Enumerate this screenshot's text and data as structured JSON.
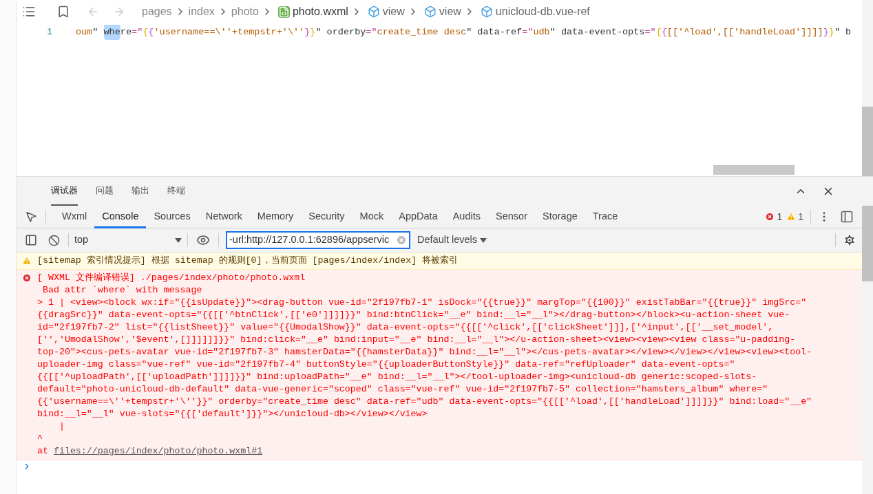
{
  "editor": {
    "breadcrumb": [
      {
        "label": "pages",
        "kind": "folder"
      },
      {
        "label": "index",
        "kind": "folder"
      },
      {
        "label": "photo",
        "kind": "folder"
      },
      {
        "label": "photo.wxml",
        "kind": "file"
      },
      {
        "label": "view",
        "kind": "node"
      },
      {
        "label": "view",
        "kind": "node"
      },
      {
        "label": "unicloud-db.vue-ref",
        "kind": "node"
      }
    ],
    "line_number": "1",
    "code": [
      {
        "text": "oum",
        "kind": "string"
      },
      {
        "text": "\" ",
        "kind": "plain"
      },
      {
        "text": "whe",
        "kind": "match"
      },
      {
        "text": "re",
        "kind": "plain"
      },
      {
        "text": "=\"",
        "kind": "eq"
      },
      {
        "text": "{",
        "kind": "brace1"
      },
      {
        "text": "{",
        "kind": "brace2"
      },
      {
        "text": "'username==\\''+tempstr+'\\''",
        "kind": "string"
      },
      {
        "text": "}",
        "kind": "brace2"
      },
      {
        "text": "}",
        "kind": "brace1"
      },
      {
        "text": "\" orderby",
        "kind": "plain"
      },
      {
        "text": "=\"",
        "kind": "eq"
      },
      {
        "text": "create_time desc",
        "kind": "string"
      },
      {
        "text": "\" data-ref",
        "kind": "plain"
      },
      {
        "text": "=\"",
        "kind": "eq"
      },
      {
        "text": "udb",
        "kind": "string"
      },
      {
        "text": "\" data-event-opts",
        "kind": "plain"
      },
      {
        "text": "=\"",
        "kind": "eq"
      },
      {
        "text": "{",
        "kind": "brace1"
      },
      {
        "text": "{",
        "kind": "brace2"
      },
      {
        "text": "[['^load',[['handleLoad']]]]",
        "kind": "string"
      },
      {
        "text": "}",
        "kind": "brace2"
      },
      {
        "text": "}",
        "kind": "brace1"
      },
      {
        "text": "\" b",
        "kind": "plain"
      }
    ]
  },
  "panel_tabs": [
    {
      "label": "调试器",
      "selected": true
    },
    {
      "label": "问题",
      "selected": false
    },
    {
      "label": "输出",
      "selected": false
    },
    {
      "label": "终端",
      "selected": false
    }
  ],
  "devtools_tabs": [
    {
      "label": "Wxml",
      "selected": false
    },
    {
      "label": "Console",
      "selected": true
    },
    {
      "label": "Sources",
      "selected": false
    },
    {
      "label": "Network",
      "selected": false
    },
    {
      "label": "Memory",
      "selected": false
    },
    {
      "label": "Security",
      "selected": false
    },
    {
      "label": "Mock",
      "selected": false
    },
    {
      "label": "AppData",
      "selected": false
    },
    {
      "label": "Audits",
      "selected": false
    },
    {
      "label": "Sensor",
      "selected": false
    },
    {
      "label": "Storage",
      "selected": false
    },
    {
      "label": "Trace",
      "selected": false
    }
  ],
  "error_count": "1",
  "warning_count": "1",
  "console_toolbar": {
    "context": "top",
    "filter_value": "-url:http://127.0.0.1:62896/appservic",
    "levels": "Default levels"
  },
  "messages": [
    {
      "kind": "warning",
      "lines": [
        "[sitemap 索引情况提示] 根据 sitemap 的规则[0]，当前页面 [pages/index/index] 将被索引"
      ]
    },
    {
      "kind": "error",
      "lines": [
        "[ WXML 文件编译错误] ./pages/index/photo/photo.wxml",
        " Bad attr `where` with message",
        "> 1 | <view><block wx:if=\"{{isUpdate}}\"><drag-button vue-id=\"2f197fb7-1\" isDock=\"{{true}}\" margTop=\"{{100}}\" existTabBar=\"{{true}}\" imgSrc=\"",
        "{{dragSrc}}\" data-event-opts=\"{{[['^btnClick',[['e0']]]]}}\" bind:btnClick=\"__e\" bind:__l=\"__l\"></drag-button></block><u-action-sheet vue-",
        "id=\"2f197fb7-2\" list=\"{{listSheet}}\" value=\"{{UmodalShow}}\" data-event-opts=\"{{[['^click',[['clickSheet']]],['^input',[['__set_model',",
        "['','UmodalShow','$event',[]]]]]]}}\" bind:click=\"__e\" bind:input=\"__e\" bind:__l=\"__l\"></u-action-sheet><view><view><view class=\"u-padding-",
        "top-20\"><cus-pets-avatar vue-id=\"2f197fb7-3\" hamsterData=\"{{hamsterData}}\" bind:__l=\"__l\"></cus-pets-avatar></view></view></view><view><tool-",
        "uploader-img class=\"vue-ref\" vue-id=\"2f197fb7-4\" buttonStyle=\"{{uploaderButtonStyle}}\" data-ref=\"refUploader\" data-event-opts=\"",
        "{{[['^uploadPath',[['uploadPath']]]]}}\" bind:uploadPath=\"__e\" bind:__l=\"__l\"></tool-uploader-img><unicloud-db generic:scoped-slots-",
        "default=\"photo-unicloud-db-default\" data-vue-generic=\"scoped\" class=\"vue-ref\" vue-id=\"2f197fb7-5\" collection=\"hamsters_album\" where=\"",
        "{{'username==\\''+tempstr+'\\''}}\" orderby=\"create_time desc\" data-ref=\"udb\" data-event-opts=\"{{[['^load',[['handleLoad']]]]}}\" bind:load=\"__e\"",
        "bind:__l=\"__l\" vue-slots=\"{{['default']}}\"></unicloud-db></view></view>",
        "    |",
        "^"
      ],
      "at": "at",
      "link": "files://pages/index/photo/photo.wxml#1"
    }
  ]
}
